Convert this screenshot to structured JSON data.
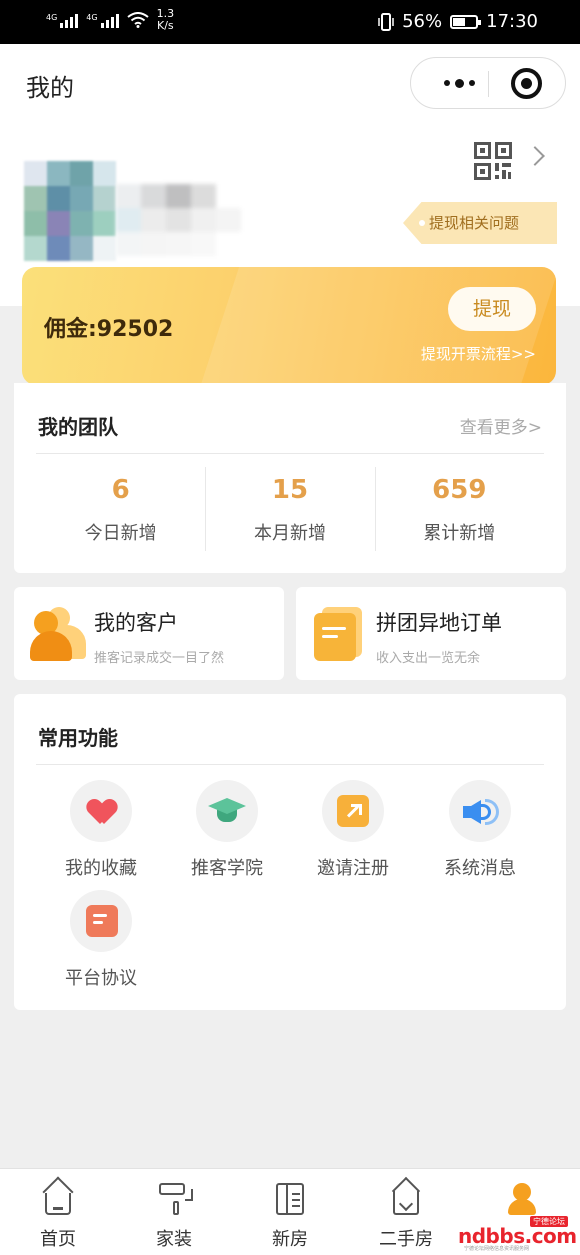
{
  "status_bar": {
    "network1": "4G",
    "network2": "4G",
    "speed_value": "1.3",
    "speed_unit": "K/s",
    "battery_percent": "56%",
    "battery_level": 0.56,
    "time": "17:30"
  },
  "header": {
    "title": "我的"
  },
  "profile": {
    "withdraw_issue_tag": "提现相关问题"
  },
  "commission_card": {
    "commission": "佣金:92502",
    "withdraw_button": "提现",
    "invoice_flow_link": "提现开票流程>>"
  },
  "team": {
    "title": "我的团队",
    "more": "查看更多>",
    "stats": [
      {
        "value": "6",
        "label": "今日新增"
      },
      {
        "value": "15",
        "label": "本月新增"
      },
      {
        "value": "659",
        "label": "累计新增"
      }
    ]
  },
  "shortcuts": {
    "customers": {
      "title": "我的客户",
      "subtitle": "推客记录成交一目了然"
    },
    "group_orders": {
      "title": "拼团异地订单",
      "subtitle": "收入支出一览无余"
    }
  },
  "functions": {
    "title": "常用功能",
    "items": [
      {
        "label": "我的收藏",
        "icon": "heart-icon"
      },
      {
        "label": "推客学院",
        "icon": "graduation-cap-icon"
      },
      {
        "label": "邀请注册",
        "icon": "invite-arrow-icon"
      },
      {
        "label": "系统消息",
        "icon": "speaker-icon"
      },
      {
        "label": "平台协议",
        "icon": "agreement-icon"
      }
    ]
  },
  "tabbar": {
    "items": [
      {
        "label": "首页",
        "icon": "home-icon"
      },
      {
        "label": "家装",
        "icon": "paint-roller-icon"
      },
      {
        "label": "新房",
        "icon": "building-icon"
      },
      {
        "label": "二手房",
        "icon": "house-heart-icon"
      },
      {
        "label": "",
        "icon": "user-icon",
        "active": true
      }
    ]
  },
  "watermark": {
    "main": "ndbbs.com",
    "badge": "宁德论坛",
    "sub": "宁德论坛网络信息资讯服务网"
  },
  "colors": {
    "accent": "#e4a04b",
    "gold_start": "#fbe07a",
    "gold_end": "#fbb63c",
    "tag_bg": "#fbe6b5",
    "tab_active": "#f5a01f"
  }
}
